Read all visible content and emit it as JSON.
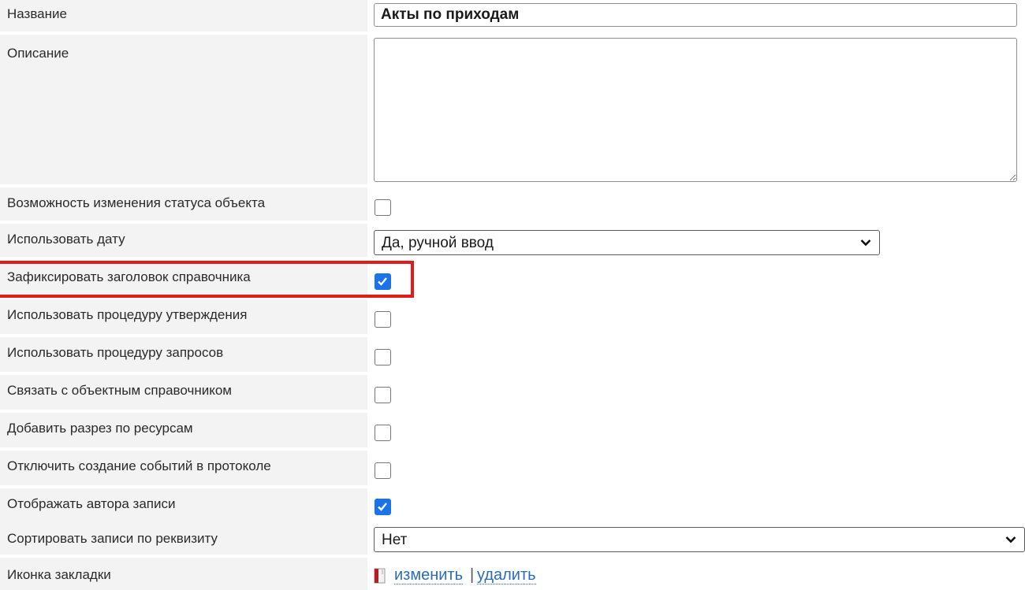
{
  "rows": {
    "name": {
      "label": "Название",
      "value": "Акты по приходам"
    },
    "description": {
      "label": "Описание",
      "value": ""
    },
    "status_change": {
      "label": "Возможность изменения статуса объекта",
      "checked": false
    },
    "use_date": {
      "label": "Использовать дату",
      "selected": "Да, ручной ввод"
    },
    "fix_header": {
      "label": "Зафиксировать заголовок справочника",
      "checked": true
    },
    "approval": {
      "label": "Использовать процедуру утверждения",
      "checked": false
    },
    "requests": {
      "label": "Использовать процедуру запросов",
      "checked": false
    },
    "link_object": {
      "label": "Связать с объектным справочником",
      "checked": false
    },
    "resource_cut": {
      "label": "Добавить разрез по ресурсам",
      "checked": false
    },
    "disable_events": {
      "label": "Отключить создание событий в протоколе",
      "checked": false
    },
    "show_author": {
      "label": "Отображать автора записи",
      "checked": true
    },
    "sort_by": {
      "label": "Сортировать записи по реквизиту",
      "selected": "Нет"
    },
    "tab_icon": {
      "label": "Иконка закладки",
      "change_link": "изменить",
      "separator": "|",
      "delete_link": "удалить",
      "icon": "book-icon"
    }
  },
  "colors": {
    "label_bg": "#f3f3f3",
    "checkbox_checked": "#1a73e8",
    "highlight": "#e41b1b",
    "link": "#2b6cb8"
  }
}
